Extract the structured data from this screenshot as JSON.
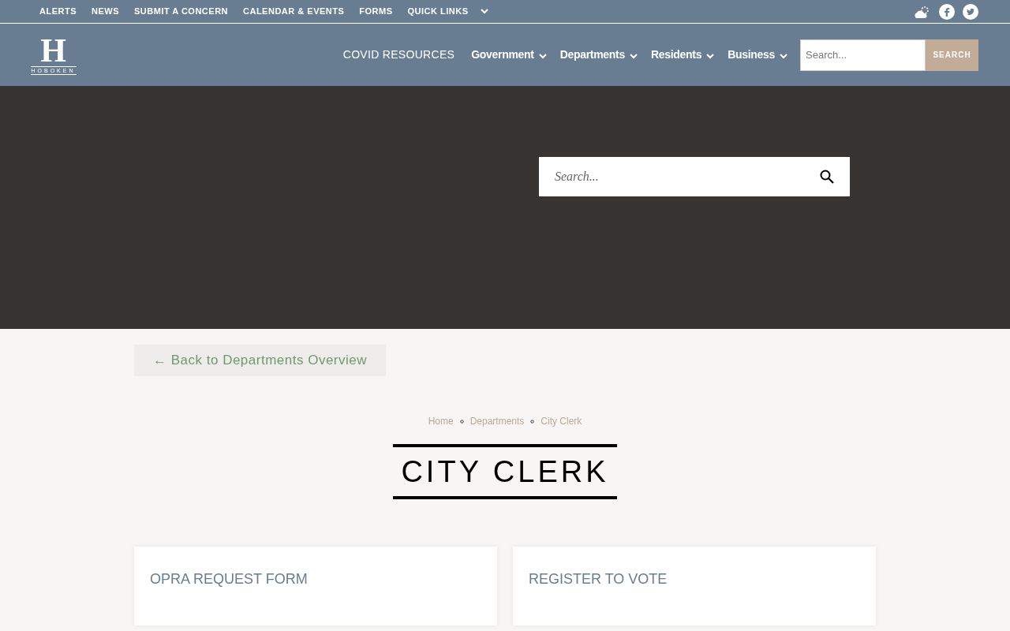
{
  "top_bar": {
    "links": [
      {
        "label": "ALERTS",
        "has_menu": false
      },
      {
        "label": "NEWS",
        "has_menu": false
      },
      {
        "label": "SUBMIT A CONCERN",
        "has_menu": false
      },
      {
        "label": "CALENDAR & EVENTS",
        "has_menu": false
      },
      {
        "label": "FORMS",
        "has_menu": false
      },
      {
        "label": "QUICK LINKS",
        "has_menu": true
      }
    ]
  },
  "header": {
    "logo_text": "HOBOKEN",
    "logo_letter": "H",
    "nav": [
      {
        "label": "COVID RESOURCES",
        "has_menu": false
      },
      {
        "label": "Government",
        "has_menu": true
      },
      {
        "label": "Departments",
        "has_menu": true
      },
      {
        "label": "Residents",
        "has_menu": true
      },
      {
        "label": "Business",
        "has_menu": true
      }
    ],
    "search": {
      "placeholder": "Search...",
      "button": "SEARCH"
    }
  },
  "hero": {
    "search": {
      "placeholder": "Search..."
    }
  },
  "back_link": "← Back to Departments Overview",
  "breadcrumbs": [
    "Home",
    "Departments",
    "City Clerk"
  ],
  "page_title": "CITY CLERK",
  "cards": [
    {
      "title": "OPRA REQUEST FORM"
    },
    {
      "title": "REGISTER TO VOTE"
    }
  ]
}
